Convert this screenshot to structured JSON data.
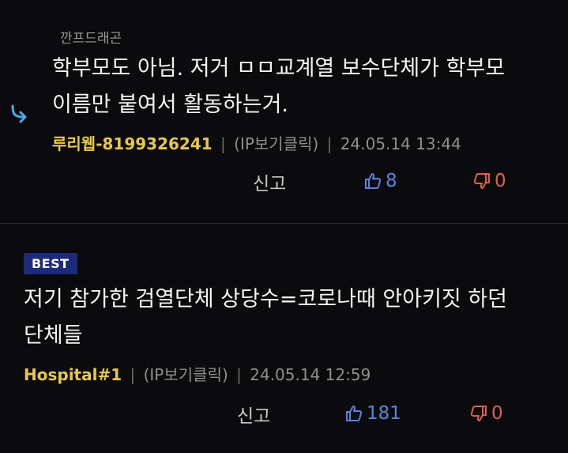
{
  "comments": [
    {
      "parent_ref": "깐프드래곤",
      "text": "학부모도 아님. 저거 ㅁㅁ교계열 보수단체가 학부모\n이름만 붙여서 활동하는거.",
      "author": "루리웹-8199326241",
      "ip_label": "(IP보기클릭)",
      "timestamp": "24.05.14 13:44",
      "report_label": "신고",
      "likes": "8",
      "dislikes": "0"
    },
    {
      "badge": "BEST",
      "text": "저기 참가한 검열단체 상당수=코로나때 안아키짓 하던\n단체들",
      "author": "Hospital#1",
      "ip_label": "(IP보기클릭)",
      "timestamp": "24.05.14 12:59",
      "report_label": "신고",
      "likes": "181",
      "dislikes": "0"
    }
  ],
  "meta_separator": "|",
  "colors": {
    "background": "#0b0b0d",
    "author": "#e8c84a",
    "like": "#5b84e0",
    "dislike": "#e06050",
    "best_badge": "#1d2b7a",
    "reply_arrow": "#4fa8e8"
  },
  "icons": {
    "reply": "reply-arrow-icon",
    "like": "thumbs-up-icon",
    "dislike": "thumbs-down-icon"
  }
}
